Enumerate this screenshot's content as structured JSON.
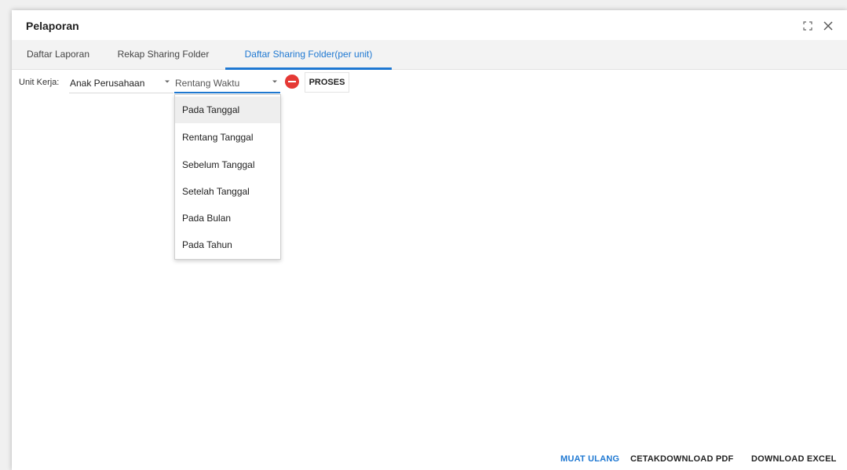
{
  "dialog": {
    "title": "Pelaporan",
    "maximize_icon": "maximize-icon",
    "close_icon": "close-icon"
  },
  "tabs": [
    {
      "label": "Daftar Laporan",
      "active": false
    },
    {
      "label": "Rekap Sharing Folder",
      "active": false
    },
    {
      "label": "Daftar Sharing Folder(per unit)",
      "active": true
    }
  ],
  "filters": {
    "unit_label": "Unit Kerja:",
    "unit_value": "Anak Perusahaan",
    "time_value": "Rentang Waktu",
    "proses_label": "PROSES"
  },
  "dropdown": {
    "options": [
      "Pada Tanggal",
      "Rentang Tanggal",
      "Sebelum Tanggal",
      "Setelah Tanggal",
      "Pada Bulan",
      "Pada Tahun"
    ],
    "highlighted": "Pada Tanggal"
  },
  "footer": {
    "reload_label": "MUAT ULANG",
    "print_label": "CETAK",
    "pdf_label": "DOWNLOAD PDF",
    "excel_label": "DOWNLOAD EXCEL"
  },
  "colors": {
    "accent": "#1e78d2",
    "danger": "#e53935"
  }
}
